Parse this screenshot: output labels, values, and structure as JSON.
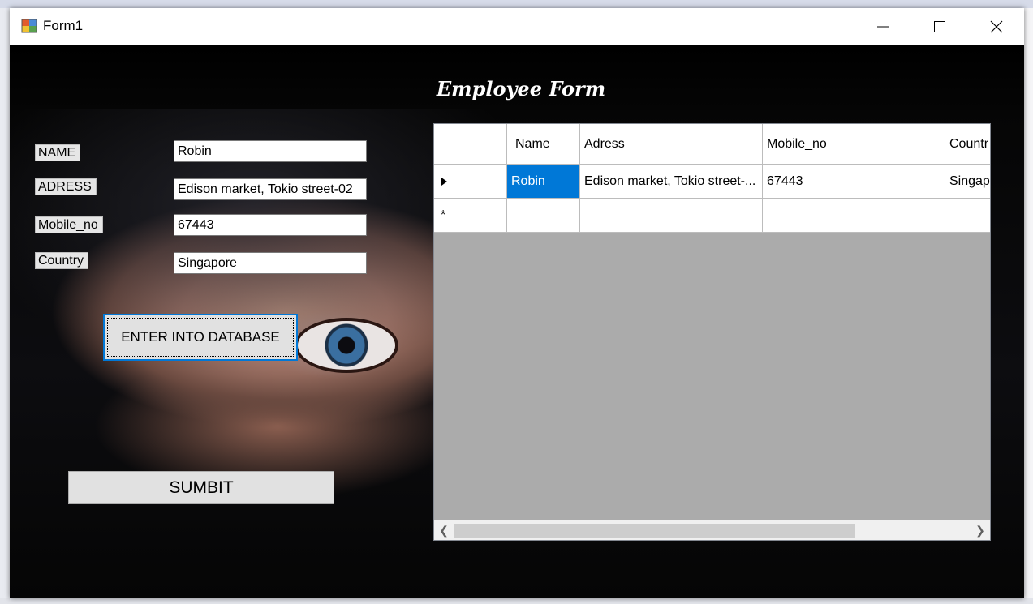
{
  "window": {
    "title": "Form1"
  },
  "form": {
    "heading": "Employee Form",
    "fields": {
      "name": {
        "label": "NAME",
        "value": "Robin"
      },
      "adress": {
        "label": "ADRESS",
        "value": "Edison market, Tokio street-02"
      },
      "mobile": {
        "label": "Mobile_no",
        "value": "67443"
      },
      "country": {
        "label": "Country",
        "value": "Singapore"
      }
    },
    "enter_button": "ENTER INTO DATABASE",
    "submit_button": "SUMBIT"
  },
  "grid": {
    "columns": [
      "Name",
      "Adress",
      "Mobile_no",
      "Countr"
    ],
    "rows": [
      {
        "name": "Robin",
        "adress": "Edison market, Tokio street-...",
        "mobile": "67443",
        "country": "Singap"
      }
    ],
    "new_row_marker": "*"
  },
  "icons": {
    "app": "form-icon",
    "minimize": "minimize-icon",
    "maximize": "maximize-icon",
    "close": "close-icon",
    "row_indicator": "triangle-right-icon"
  },
  "colors": {
    "selection": "#0078d7",
    "grid_background": "#ababab"
  }
}
